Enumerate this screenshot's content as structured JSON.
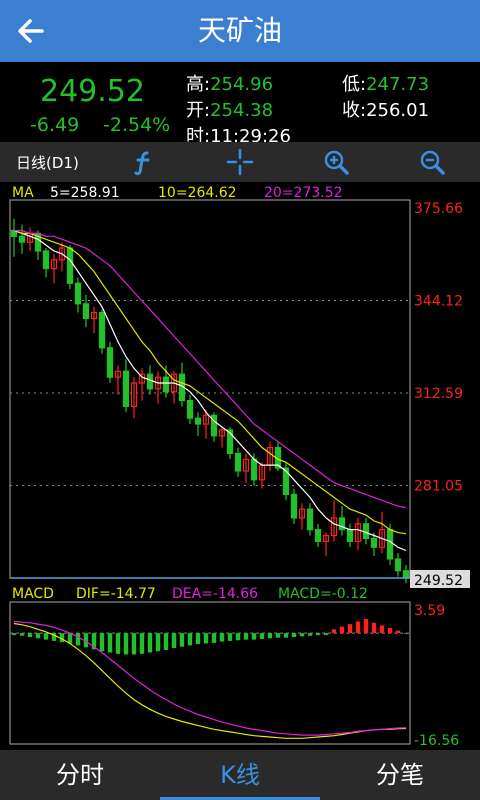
{
  "header": {
    "title": "天矿油",
    "back_icon": "back-arrow-icon"
  },
  "quote": {
    "price": "249.52",
    "change": "-6.49",
    "change_pct": "-2.54%",
    "high_label": "高:",
    "high": "254.96",
    "open_label": "开:",
    "open": "254.38",
    "time_label": "时:",
    "time": "11:29:26",
    "low_label": "低:",
    "low": "247.73",
    "close_label": "收:",
    "close": "256.01"
  },
  "toolbar": {
    "period": "日线(D1)",
    "icons": [
      "formula-icon",
      "crosshair-icon",
      "zoom-in-icon",
      "zoom-out-icon"
    ]
  },
  "colors": {
    "up": "#ff2020",
    "down": "#22c12a",
    "ma5": "#ffffff",
    "ma10": "#e6e600",
    "ma20": "#e020e0",
    "accent": "#3a7fd0"
  },
  "chart_data": [
    {
      "type": "candlestick",
      "indicator_label": "MA",
      "ma_labels": [
        "5=258.91",
        "10=264.62",
        "20=273.52"
      ],
      "y_ticks": [
        "375.66",
        "344.12",
        "312.59",
        "281.05",
        "249.52"
      ],
      "ylim": [
        249.52,
        375.66
      ],
      "last_price_tag": "249.52",
      "candles": [
        [
          368,
          372,
          359,
          366
        ],
        [
          366,
          370,
          360,
          364
        ],
        [
          364,
          369,
          361,
          367
        ],
        [
          367,
          368,
          358,
          361
        ],
        [
          361,
          362,
          352,
          355
        ],
        [
          355,
          360,
          350,
          358
        ],
        [
          358,
          364,
          354,
          362
        ],
        [
          362,
          363,
          348,
          350
        ],
        [
          350,
          352,
          340,
          343
        ],
        [
          343,
          346,
          335,
          338
        ],
        [
          338,
          342,
          333,
          340
        ],
        [
          340,
          341,
          326,
          328
        ],
        [
          328,
          330,
          316,
          318
        ],
        [
          318,
          322,
          312,
          320
        ],
        [
          320,
          324,
          306,
          308
        ],
        [
          308,
          318,
          304,
          316
        ],
        [
          316,
          321,
          310,
          319
        ],
        [
          319,
          322,
          312,
          314
        ],
        [
          314,
          320,
          309,
          318
        ],
        [
          318,
          322,
          311,
          313
        ],
        [
          313,
          320,
          309,
          319
        ],
        [
          319,
          323,
          308,
          310
        ],
        [
          310,
          312,
          302,
          304
        ],
        [
          304,
          306,
          298,
          302
        ],
        [
          302,
          307,
          297,
          305
        ],
        [
          305,
          306,
          296,
          298
        ],
        [
          298,
          301,
          294,
          300
        ],
        [
          300,
          301,
          290,
          292
        ],
        [
          292,
          294,
          284,
          286
        ],
        [
          286,
          292,
          282,
          290
        ],
        [
          290,
          292,
          281,
          283
        ],
        [
          283,
          289,
          280,
          288
        ],
        [
          288,
          296,
          286,
          294
        ],
        [
          294,
          296,
          286,
          287
        ],
        [
          287,
          289,
          276,
          278
        ],
        [
          278,
          280,
          268,
          270
        ],
        [
          270,
          275,
          266,
          273
        ],
        [
          273,
          275,
          264,
          266
        ],
        [
          266,
          268,
          260,
          262
        ],
        [
          262,
          265,
          257,
          264
        ],
        [
          264,
          276,
          262,
          270
        ],
        [
          270,
          274,
          264,
          266
        ],
        [
          266,
          268,
          260,
          262
        ],
        [
          262,
          270,
          259,
          268
        ],
        [
          268,
          270,
          261,
          263
        ],
        [
          263,
          265,
          257,
          260
        ],
        [
          260,
          272,
          258,
          266
        ],
        [
          266,
          268,
          254,
          256
        ],
        [
          256,
          258,
          250,
          252
        ],
        [
          252,
          254,
          247.73,
          249.52
        ]
      ],
      "ma5": [
        368,
        367,
        366,
        365,
        363,
        361,
        360,
        358,
        354,
        350,
        346,
        342,
        336,
        330,
        325,
        321,
        318,
        317,
        316,
        316,
        316,
        315,
        313,
        310,
        306,
        303,
        301,
        299,
        296,
        293,
        290,
        288,
        288,
        288,
        286,
        283,
        280,
        277,
        273,
        270,
        268,
        267,
        266,
        266,
        265,
        264,
        263,
        262,
        260,
        258.91
      ],
      "ma10": [
        368,
        367,
        367,
        366,
        365,
        364,
        363,
        362,
        360,
        357,
        354,
        350,
        346,
        342,
        338,
        334,
        330,
        327,
        323,
        320,
        317,
        316,
        315,
        313,
        311,
        309,
        307,
        305,
        303,
        300,
        297,
        294,
        292,
        290,
        289,
        287,
        285,
        283,
        281,
        279,
        277,
        275,
        273,
        272,
        271,
        269,
        268,
        266,
        265,
        264.62
      ],
      "ma20": [
        368,
        368,
        367,
        367,
        366,
        366,
        365,
        364,
        363,
        362,
        360,
        358,
        356,
        353,
        350,
        347,
        344,
        341,
        338,
        335,
        332,
        329,
        326,
        323,
        320,
        317,
        314,
        311,
        308,
        305,
        302,
        300,
        298,
        296,
        294,
        292,
        290,
        288,
        286,
        284,
        282,
        281,
        280,
        279,
        278,
        277,
        276,
        275,
        274,
        273.52
      ]
    },
    {
      "type": "macd",
      "label": "MACD",
      "dif_label": "DIF=-14.77",
      "dea_label": "DEA=-14.66",
      "macd_label": "MACD=-0.12",
      "y_ticks": [
        "3.59",
        "-16.56"
      ],
      "ylim": [
        -16.56,
        3.59
      ],
      "dif": [
        1.5,
        1.3,
        1.0,
        0.6,
        0.2,
        -0.3,
        -0.9,
        -1.6,
        -2.5,
        -3.5,
        -4.6,
        -5.8,
        -7.0,
        -8.2,
        -9.3,
        -10.3,
        -11.1,
        -11.8,
        -12.4,
        -12.9,
        -13.3,
        -13.7,
        -14.0,
        -14.3,
        -14.6,
        -14.9,
        -15.1,
        -15.3,
        -15.5,
        -15.7,
        -15.9,
        -16.0,
        -16.1,
        -16.2,
        -16.3,
        -16.3,
        -16.3,
        -16.2,
        -16.1,
        -16.0,
        -15.9,
        -15.7,
        -15.5,
        -15.3,
        -15.1,
        -15.0,
        -14.9,
        -14.9,
        -14.8,
        -14.77
      ],
      "dea": [
        1.8,
        1.7,
        1.6,
        1.4,
        1.2,
        0.9,
        0.5,
        0.0,
        -0.6,
        -1.3,
        -2.1,
        -3.0,
        -4.0,
        -5.0,
        -6.0,
        -7.0,
        -7.9,
        -8.8,
        -9.6,
        -10.3,
        -11.0,
        -11.6,
        -12.1,
        -12.6,
        -13.0,
        -13.4,
        -13.8,
        -14.1,
        -14.4,
        -14.7,
        -14.9,
        -15.1,
        -15.3,
        -15.5,
        -15.6,
        -15.7,
        -15.8,
        -15.8,
        -15.8,
        -15.7,
        -15.6,
        -15.5,
        -15.4,
        -15.2,
        -15.1,
        -15.0,
        -14.9,
        -14.8,
        -14.7,
        -14.66
      ],
      "macd": [
        -0.3,
        -0.4,
        -0.6,
        -0.8,
        -1.0,
        -1.2,
        -1.4,
        -1.6,
        -1.9,
        -2.2,
        -2.5,
        -2.8,
        -3.0,
        -3.2,
        -3.3,
        -3.3,
        -3.2,
        -3.0,
        -2.8,
        -2.6,
        -2.3,
        -2.1,
        -1.9,
        -1.7,
        -1.6,
        -1.5,
        -1.3,
        -1.2,
        -1.1,
        -1.0,
        -1.0,
        -0.9,
        -0.8,
        -0.7,
        -0.7,
        -0.6,
        -0.5,
        -0.4,
        -0.3,
        -0.3,
        0.6,
        1.0,
        1.4,
        1.8,
        2.2,
        1.6,
        1.2,
        0.8,
        0.4,
        -0.12
      ]
    }
  ],
  "tabs": {
    "fenshi": "分时",
    "kline": "K线",
    "fenbi": "分笔"
  }
}
